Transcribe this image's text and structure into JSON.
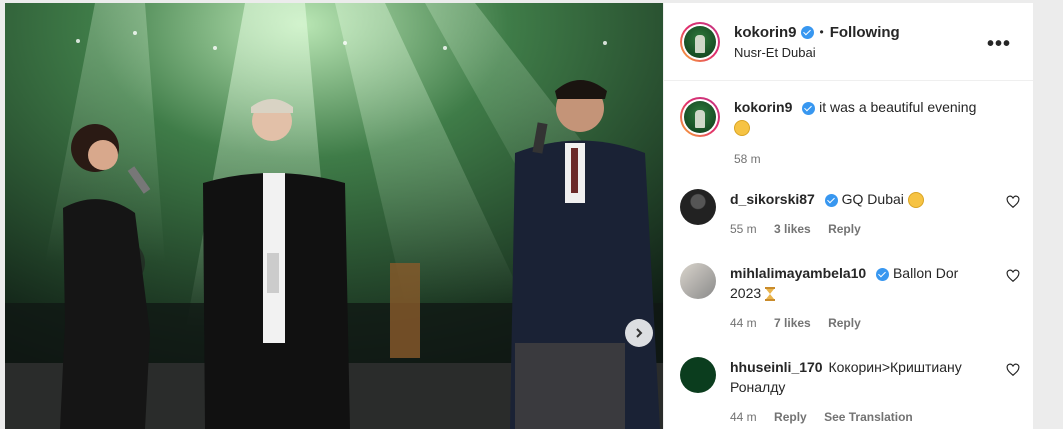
{
  "post": {
    "author": "kokorin9",
    "follow_status": "Following",
    "location": "Nusr-Et Dubai",
    "more_label": "•••"
  },
  "caption": {
    "username": "kokorin9",
    "text": "it was a beautiful evening",
    "time": "58 m"
  },
  "comments": [
    {
      "username": "d_sikorski87",
      "text": "GQ Dubai",
      "time": "55 m",
      "likes": "3 likes",
      "reply": "Reply"
    },
    {
      "username": "mihlalimayambela10",
      "text": "Ballon Dor 2023",
      "time": "44 m",
      "likes": "7 likes",
      "reply": "Reply"
    },
    {
      "username": "hhuseinli_170",
      "text": "Кокорин>Криштиану Роналду",
      "time": "44 m",
      "reply": "Reply",
      "translate": "See Translation"
    }
  ],
  "icons": {
    "verified": "verified-badge-icon",
    "heart": "heart-icon",
    "next": "chevron-right-icon"
  },
  "colors": {
    "accent": "#3897f0",
    "text": "#262626",
    "muted": "#737373"
  }
}
